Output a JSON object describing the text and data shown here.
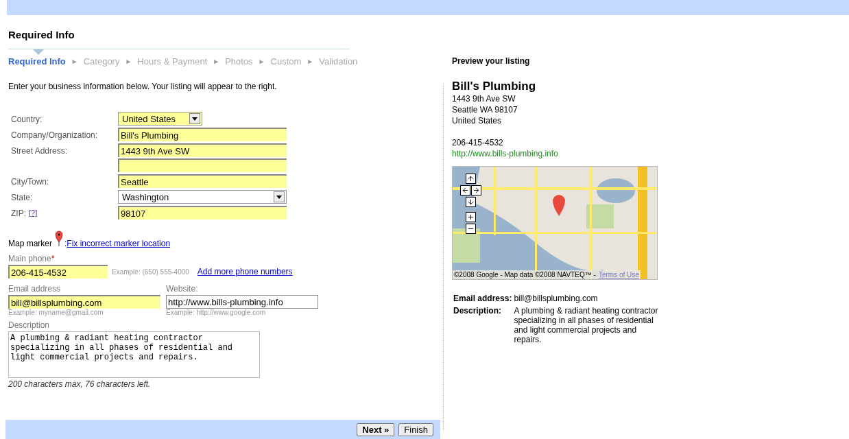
{
  "title": "Required Info",
  "steps": [
    {
      "label": "Required Info",
      "selected": true
    },
    {
      "label": "Category",
      "selected": false
    },
    {
      "label": "Hours & Payment",
      "selected": false
    },
    {
      "label": "Photos",
      "selected": false
    },
    {
      "label": "Custom",
      "selected": false
    },
    {
      "label": "Validation",
      "selected": false
    }
  ],
  "step_separator": "►",
  "intro": "Enter your business information below. Your listing will appear to the right.",
  "address_fields": [
    {
      "label": "Country:",
      "kind": "short_select",
      "value": "United States"
    },
    {
      "label": "Company/Organization:",
      "kind": "text",
      "value": "Bill's Plumbing"
    },
    {
      "label": "Street Address:",
      "kind": "double",
      "value": "1443 9th Ave SW"
    },
    {
      "label": "City/Town:",
      "kind": "text",
      "value": "Seattle"
    },
    {
      "label": "State:",
      "kind": "select",
      "value": "Washington"
    },
    {
      "label": "ZIP:",
      "kind": "text",
      "value": "98107",
      "help": "[?]"
    }
  ],
  "map_marker": {
    "label": "Map marker",
    "separator": ":",
    "link": "Fix incorrect marker location"
  },
  "phone": {
    "label": "Main phone",
    "required_mark": "*",
    "value": "206-415-4532",
    "example": "Example: (650) 555-4000",
    "link": "Add more phone numbers"
  },
  "email": {
    "label": "Email address",
    "value": "bill@billsplumbing.com",
    "example": "Example: myname@gmail.com"
  },
  "website": {
    "label": "Website:",
    "value": "http://www.bills-plumbing.info",
    "example": "Example: http://www.google.com"
  },
  "description": {
    "label": "Description",
    "value": "A plumbing & radiant heating contractor specializing in all phases of residential and light commercial projects and repairs.",
    "counter": "200 characters max, 76 characters left."
  },
  "buttons": [
    {
      "label": "Next »",
      "primary": true
    },
    {
      "label": "Finish",
      "primary": false
    }
  ],
  "preview": {
    "heading": "Preview your listing",
    "name": "Bill's Plumbing",
    "address_lines": [
      "1443 9th Ave SW",
      "Seattle WA 98107",
      "United States"
    ],
    "phone": "206-415-4532",
    "website": "http://www.bills-plumbing.info",
    "map": {
      "kind": "picture",
      "attribution": "©2008 Google - Map data ©2008 NAVTEQ™ -",
      "terms": "Terms of Use"
    },
    "details": [
      {
        "label": "Email address:",
        "value": "bill@billsplumbing.com"
      },
      {
        "label": "Description:",
        "value": "A plumbing & radiant heating contractor specializing in all phases of residential and light commercial projects and repairs."
      }
    ]
  }
}
